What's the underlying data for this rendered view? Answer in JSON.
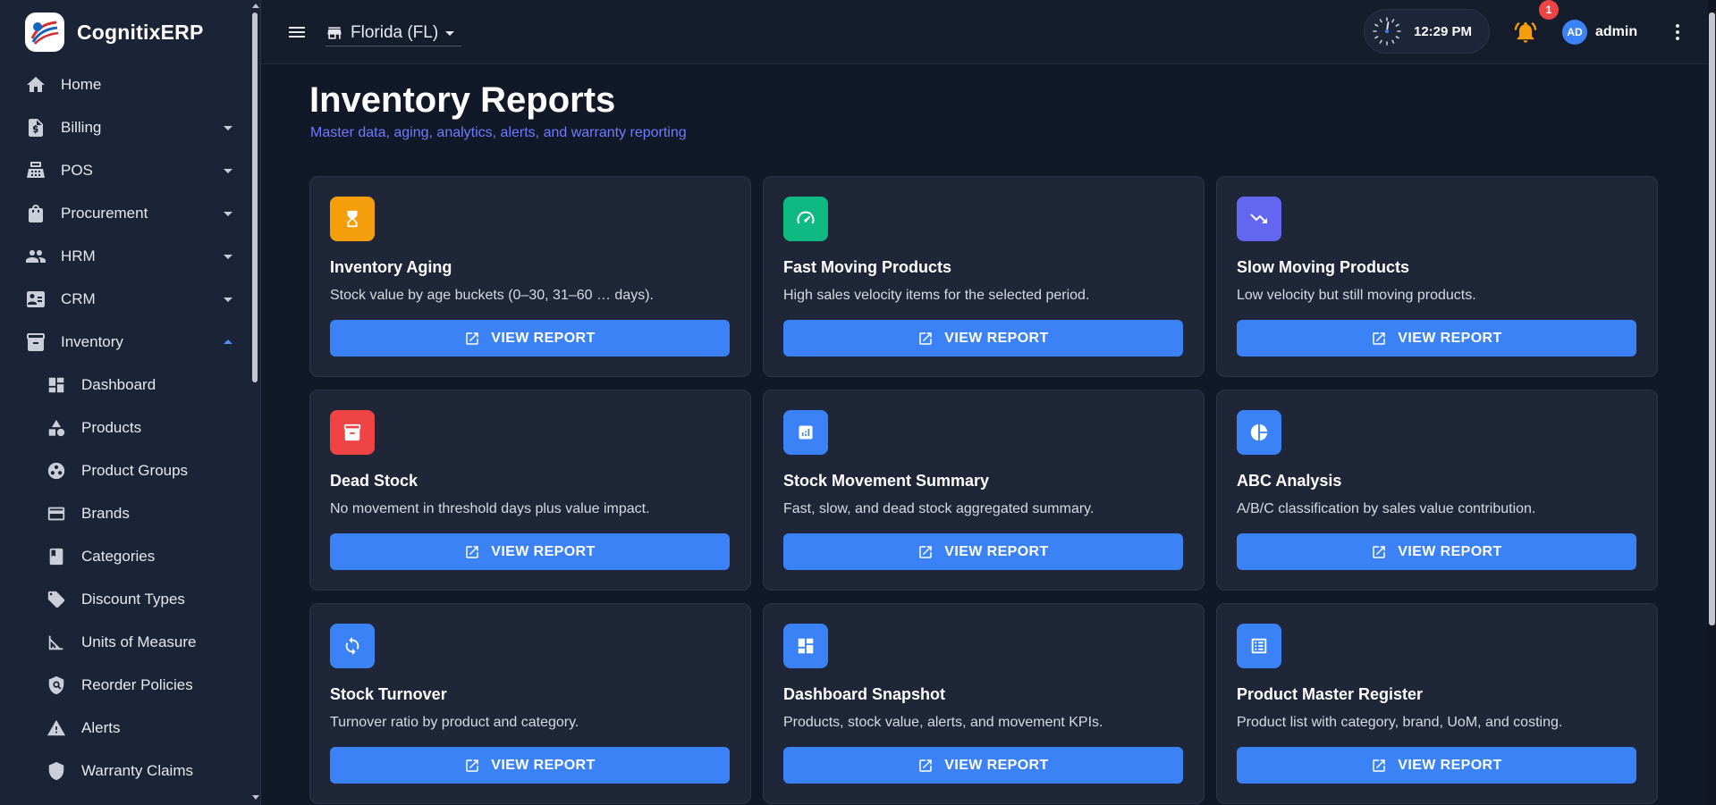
{
  "app": {
    "brand": "CognitixERP"
  },
  "sidebar": {
    "items": [
      {
        "label": "Home",
        "icon": "home-icon",
        "has_caret": false
      },
      {
        "label": "Billing",
        "icon": "invoice-icon",
        "has_caret": true,
        "expanded": false
      },
      {
        "label": "POS",
        "icon": "cash-register-icon",
        "has_caret": true,
        "expanded": false
      },
      {
        "label": "Procurement",
        "icon": "shopping-bag-icon",
        "has_caret": true,
        "expanded": false
      },
      {
        "label": "HRM",
        "icon": "people-icon",
        "has_caret": true,
        "expanded": false
      },
      {
        "label": "CRM",
        "icon": "contact-card-icon",
        "has_caret": true,
        "expanded": false
      },
      {
        "label": "Inventory",
        "icon": "archive-icon",
        "has_caret": true,
        "expanded": true
      }
    ],
    "inventory_sub": [
      {
        "label": "Dashboard",
        "icon": "dashboard-icon"
      },
      {
        "label": "Products",
        "icon": "shapes-icon"
      },
      {
        "label": "Product Groups",
        "icon": "workspaces-icon"
      },
      {
        "label": "Brands",
        "icon": "brand-card-icon"
      },
      {
        "label": "Categories",
        "icon": "book-icon"
      },
      {
        "label": "Discount Types",
        "icon": "tag-icon"
      },
      {
        "label": "Units of Measure",
        "icon": "ruler-icon"
      },
      {
        "label": "Reorder Policies",
        "icon": "policy-shield-icon"
      },
      {
        "label": "Alerts",
        "icon": "warning-icon"
      },
      {
        "label": "Warranty Claims",
        "icon": "shield-icon"
      }
    ]
  },
  "topbar": {
    "store": "Florida (FL)",
    "time": "12:29 PM",
    "notifications": "1",
    "avatar_initials": "AD",
    "username": "admin"
  },
  "page": {
    "title": "Inventory Reports",
    "subtitle": "Master data, aging, analytics, alerts, and warranty reporting",
    "button_label": "VIEW REPORT"
  },
  "reports": [
    {
      "title": "Inventory Aging",
      "desc": "Stock value by age buckets (0–30, 31–60 … days).",
      "icon": "hourglass-icon",
      "color": "#f59e0b"
    },
    {
      "title": "Fast Moving Products",
      "desc": "High sales velocity items for the selected period.",
      "icon": "speedometer-icon",
      "color": "#10b981"
    },
    {
      "title": "Slow Moving Products",
      "desc": "Low velocity but still moving products.",
      "icon": "trending-down-icon",
      "color": "#6366f1"
    },
    {
      "title": "Dead Stock",
      "desc": "No movement in threshold days plus value impact.",
      "icon": "archive-box-icon",
      "color": "#ef4444"
    },
    {
      "title": "Stock Movement Summary",
      "desc": "Fast, slow, and dead stock aggregated summary.",
      "icon": "bar-chart-icon",
      "color": "#3b82f6"
    },
    {
      "title": "ABC Analysis",
      "desc": "A/B/C classification by sales value contribution.",
      "icon": "pie-chart-icon",
      "color": "#3b82f6"
    },
    {
      "title": "Stock Turnover",
      "desc": "Turnover ratio by product and category.",
      "icon": "refresh-icon",
      "color": "#3b82f6"
    },
    {
      "title": "Dashboard Snapshot",
      "desc": "Products, stock value, alerts, and movement KPIs.",
      "icon": "dashboard-icon",
      "color": "#3b82f6"
    },
    {
      "title": "Product Master Register",
      "desc": "Product list with category, brand, UoM, and costing.",
      "icon": "list-alt-icon",
      "color": "#3b82f6"
    }
  ]
}
